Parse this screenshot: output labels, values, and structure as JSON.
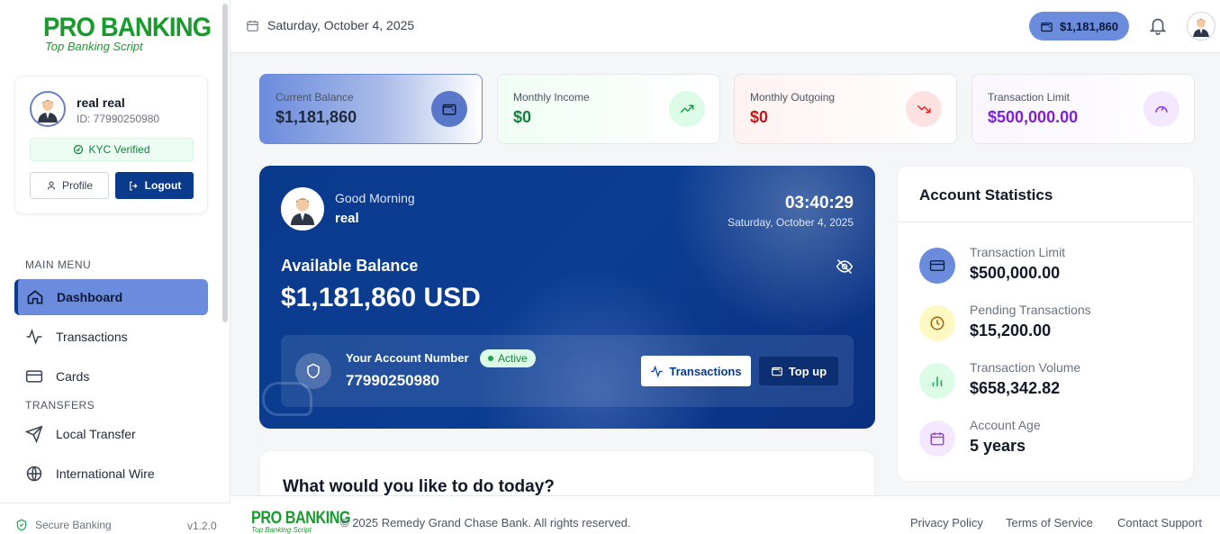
{
  "brand": {
    "name": "PRO BANKING",
    "tagline": "Top Banking Script"
  },
  "user": {
    "full_name": "real real",
    "id_label": "ID: 77990250980",
    "kyc_status": "KYC Verified",
    "profile_label": "Profile",
    "logout_label": "Logout"
  },
  "sidebar": {
    "main_menu_heading": "MAIN MENU",
    "main_items": [
      {
        "label": "Dashboard",
        "icon": "home-icon",
        "active": true
      },
      {
        "label": "Transactions",
        "icon": "activity-icon"
      },
      {
        "label": "Cards",
        "icon": "credit-card-icon"
      }
    ],
    "transfers_heading": "TRANSFERS",
    "transfer_items": [
      {
        "label": "Local Transfer",
        "icon": "send-icon"
      },
      {
        "label": "International Wire",
        "icon": "globe-icon"
      }
    ],
    "footer": {
      "secure_label": "Secure Banking",
      "version": "v1.2.0"
    }
  },
  "topbar": {
    "date": "Saturday, October 4, 2025",
    "balance": "$1,181,860"
  },
  "stats": [
    {
      "label": "Current Balance",
      "value": "$1,181,860",
      "icon": "wallet-icon",
      "color": "#1e293b"
    },
    {
      "label": "Monthly Income",
      "value": "$0",
      "icon": "trending-up-icon",
      "color": "#15803d"
    },
    {
      "label": "Monthly Outgoing",
      "value": "$0",
      "icon": "trending-down-icon",
      "color": "#b91c1c"
    },
    {
      "label": "Transaction Limit",
      "value": "$500,000.00",
      "icon": "gauge-icon",
      "color": "#7e22ce"
    }
  ],
  "hero": {
    "greeting": "Good Morning",
    "name": "real",
    "time": "03:40:29",
    "date": "Saturday, October 4, 2025",
    "available_label": "Available Balance",
    "amount": "$1,181,860 USD",
    "account_label": "Your Account Number",
    "account_status": "Active",
    "account_number": "77990250980",
    "transactions_button": "Transactions",
    "topup_button": "Top up"
  },
  "action": {
    "title": "What would you like to do today?"
  },
  "account_statistics": {
    "title": "Account Statistics",
    "rows": [
      {
        "label": "Transaction Limit",
        "value": "$500,000.00",
        "icon": "credit-card-icon"
      },
      {
        "label": "Pending Transactions",
        "value": "$15,200.00",
        "icon": "clock-icon"
      },
      {
        "label": "Transaction Volume",
        "value": "$658,342.82",
        "icon": "bar-chart-icon"
      },
      {
        "label": "Account Age",
        "value": "5 years",
        "icon": "calendar-icon"
      }
    ]
  },
  "footer": {
    "logo_name": "PRO BANKING",
    "logo_tagline": "Top Banking Script",
    "copyright": "© 2025 Remedy Grand Chase Bank. All rights reserved.",
    "links": [
      "Privacy Policy",
      "Terms of Service",
      "Contact Support"
    ]
  },
  "colors": {
    "primary": "#0a3a8c",
    "accent": "#6b8bdc",
    "brand_green": "#1a9a2e"
  }
}
